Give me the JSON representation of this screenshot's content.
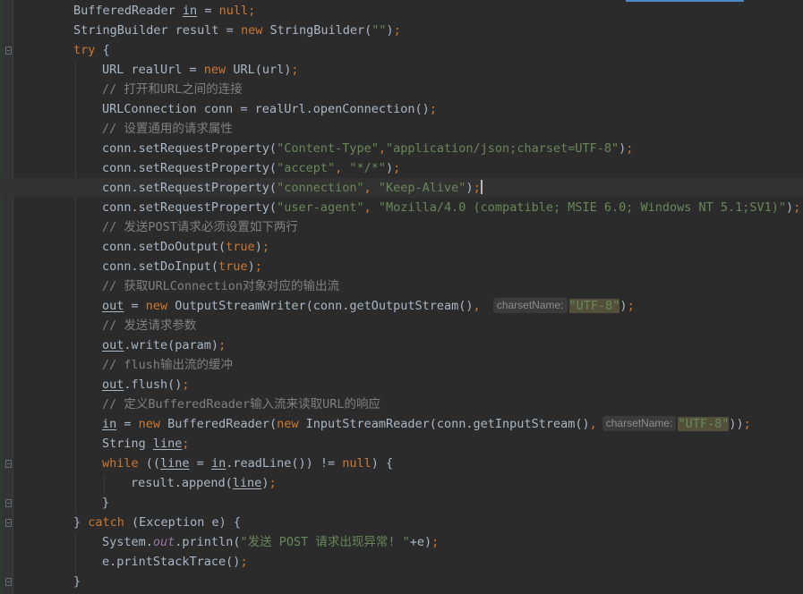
{
  "editor": {
    "lines": [
      {
        "id": "l1",
        "indent": 0,
        "tokens": [
          {
            "t": "BufferedReader "
          },
          {
            "t": "in",
            "c": "ul"
          },
          {
            "t": " = "
          },
          {
            "t": "null",
            "c": "kw"
          },
          {
            "t": ";",
            "c": "kw"
          }
        ]
      },
      {
        "id": "l2",
        "indent": 0,
        "tokens": [
          {
            "t": "StringBuilder result = "
          },
          {
            "t": "new ",
            "c": "kw"
          },
          {
            "t": "StringBuilder("
          },
          {
            "t": "\"\"",
            "c": "str"
          },
          {
            "t": ")"
          },
          {
            "t": ";",
            "c": "kw"
          }
        ]
      },
      {
        "id": "l3",
        "indent": 0,
        "tokens": [
          {
            "t": "try ",
            "c": "kw"
          },
          {
            "t": "{"
          }
        ]
      },
      {
        "id": "l4",
        "indent": 1,
        "tokens": [
          {
            "t": "URL realUrl = "
          },
          {
            "t": "new ",
            "c": "kw"
          },
          {
            "t": "URL(url)"
          },
          {
            "t": ";",
            "c": "kw"
          }
        ]
      },
      {
        "id": "l5",
        "indent": 1,
        "tokens": [
          {
            "t": "// 打开和URL之间的连接",
            "c": "cmt"
          }
        ]
      },
      {
        "id": "l6",
        "indent": 1,
        "tokens": [
          {
            "t": "URLConnection conn = realUrl.openConnection()"
          },
          {
            "t": ";",
            "c": "kw"
          }
        ]
      },
      {
        "id": "l7",
        "indent": 1,
        "tokens": [
          {
            "t": "// 设置通用的请求属性",
            "c": "cmt"
          }
        ]
      },
      {
        "id": "l8",
        "indent": 1,
        "tokens": [
          {
            "t": "conn.setRequestProperty("
          },
          {
            "t": "\"Content-Type\"",
            "c": "str"
          },
          {
            "t": ",",
            "c": "kw"
          },
          {
            "t": "\"application/json;charset=UTF-8\"",
            "c": "str"
          },
          {
            "t": ")"
          },
          {
            "t": ";",
            "c": "kw"
          }
        ]
      },
      {
        "id": "l9",
        "indent": 1,
        "tokens": [
          {
            "t": "conn.setRequestProperty("
          },
          {
            "t": "\"accept\"",
            "c": "str"
          },
          {
            "t": ", ",
            "c": "kw"
          },
          {
            "t": "\"*/*\"",
            "c": "str"
          },
          {
            "t": ")"
          },
          {
            "t": ";",
            "c": "kw"
          }
        ]
      },
      {
        "id": "l10",
        "indent": 1,
        "current": true,
        "tokens": [
          {
            "t": "conn.setRequestProperty("
          },
          {
            "t": "\"connection\"",
            "c": "str"
          },
          {
            "t": ", ",
            "c": "kw"
          },
          {
            "t": "\"Keep-Alive\"",
            "c": "str"
          },
          {
            "t": ")"
          },
          {
            "t": ";",
            "c": "kw"
          },
          {
            "caret": true
          }
        ]
      },
      {
        "id": "l11",
        "indent": 1,
        "tokens": [
          {
            "t": "conn.setRequestProperty("
          },
          {
            "t": "\"user-agent\"",
            "c": "str"
          },
          {
            "t": ", ",
            "c": "kw"
          },
          {
            "t": "\"Mozilla/4.0 (compatible; MSIE 6.0; Windows NT 5.1;SV1)\"",
            "c": "str"
          },
          {
            "t": ")"
          },
          {
            "t": ";",
            "c": "kw"
          }
        ]
      },
      {
        "id": "l12",
        "indent": 1,
        "tokens": [
          {
            "t": "// 发送POST请求必须设置如下两行",
            "c": "cmt"
          }
        ]
      },
      {
        "id": "l13",
        "indent": 1,
        "tokens": [
          {
            "t": "conn.setDoOutput("
          },
          {
            "t": "true",
            "c": "kw"
          },
          {
            "t": ")"
          },
          {
            "t": ";",
            "c": "kw"
          }
        ]
      },
      {
        "id": "l14",
        "indent": 1,
        "tokens": [
          {
            "t": "conn.setDoInput("
          },
          {
            "t": "true",
            "c": "kw"
          },
          {
            "t": ")"
          },
          {
            "t": ";",
            "c": "kw"
          }
        ]
      },
      {
        "id": "l15",
        "indent": 1,
        "tokens": [
          {
            "t": "// 获取URLConnection对象对应的输出流",
            "c": "cmt"
          }
        ]
      },
      {
        "id": "l16",
        "indent": 1,
        "tokens": [
          {
            "t": "out",
            "c": "ul"
          },
          {
            "t": " = "
          },
          {
            "t": "new ",
            "c": "kw"
          },
          {
            "t": "OutputStreamWriter(conn.getOutputStream()"
          },
          {
            "t": ", ",
            "c": "kw"
          },
          {
            "t": "charsetName:",
            "c": "hint"
          },
          {
            "t": "\"UTF-8\"",
            "c": "str hl"
          },
          {
            "t": ")"
          },
          {
            "t": ";",
            "c": "kw"
          }
        ]
      },
      {
        "id": "l17",
        "indent": 1,
        "tokens": [
          {
            "t": "// 发送请求参数",
            "c": "cmt"
          }
        ]
      },
      {
        "id": "l18",
        "indent": 1,
        "tokens": [
          {
            "t": "out",
            "c": "ul"
          },
          {
            "t": ".write(param)"
          },
          {
            "t": ";",
            "c": "kw"
          }
        ]
      },
      {
        "id": "l19",
        "indent": 1,
        "tokens": [
          {
            "t": "// flush输出流的缓冲",
            "c": "cmt"
          }
        ]
      },
      {
        "id": "l20",
        "indent": 1,
        "tokens": [
          {
            "t": "out",
            "c": "ul"
          },
          {
            "t": ".flush()"
          },
          {
            "t": ";",
            "c": "kw"
          }
        ]
      },
      {
        "id": "l21",
        "indent": 1,
        "tokens": [
          {
            "t": "// 定义BufferedReader输入流来读取URL的响应",
            "c": "cmt"
          }
        ]
      },
      {
        "id": "l22",
        "indent": 1,
        "tokens": [
          {
            "t": "in",
            "c": "ul"
          },
          {
            "t": " = "
          },
          {
            "t": "new ",
            "c": "kw"
          },
          {
            "t": "BufferedReader("
          },
          {
            "t": "new ",
            "c": "kw"
          },
          {
            "t": "InputStreamReader(conn.getInputStream()"
          },
          {
            "t": ",",
            "c": "kw"
          },
          {
            "t": "charsetName:",
            "c": "hint"
          },
          {
            "t": "\"UTF-8\"",
            "c": "str hl"
          },
          {
            "t": "))"
          },
          {
            "t": ";",
            "c": "kw"
          }
        ]
      },
      {
        "id": "l23",
        "indent": 1,
        "tokens": [
          {
            "t": "String "
          },
          {
            "t": "line",
            "c": "ul"
          },
          {
            "t": ";",
            "c": "kw"
          }
        ]
      },
      {
        "id": "l24",
        "indent": 1,
        "tokens": [
          {
            "t": "while ",
            "c": "kw"
          },
          {
            "t": "(("
          },
          {
            "t": "line",
            "c": "ul"
          },
          {
            "t": " = "
          },
          {
            "t": "in",
            "c": "ul"
          },
          {
            "t": ".readLine()) != "
          },
          {
            "t": "null",
            "c": "kw"
          },
          {
            "t": ") {"
          }
        ]
      },
      {
        "id": "l25",
        "indent": 2,
        "tokens": [
          {
            "t": "result.append("
          },
          {
            "t": "line",
            "c": "ul"
          },
          {
            "t": ")"
          },
          {
            "t": ";",
            "c": "kw"
          }
        ]
      },
      {
        "id": "l26",
        "indent": 1,
        "tokens": [
          {
            "t": "}"
          }
        ]
      },
      {
        "id": "l27",
        "indent": 0,
        "tokens": [
          {
            "t": "} "
          },
          {
            "t": "catch ",
            "c": "kw"
          },
          {
            "t": "(Exception e) {"
          }
        ]
      },
      {
        "id": "l28",
        "indent": 1,
        "tokens": [
          {
            "t": "System."
          },
          {
            "t": "out",
            "c": "field"
          },
          {
            "t": ".println("
          },
          {
            "t": "\"发送 POST 请求出现异常! \"",
            "c": "str"
          },
          {
            "t": "+e)"
          },
          {
            "t": ";",
            "c": "kw"
          }
        ]
      },
      {
        "id": "l29",
        "indent": 1,
        "tokens": [
          {
            "t": "e.printStackTrace()"
          },
          {
            "t": ";",
            "c": "kw"
          }
        ]
      },
      {
        "id": "l30",
        "indent": 0,
        "tokens": [
          {
            "t": "}"
          }
        ]
      }
    ]
  }
}
